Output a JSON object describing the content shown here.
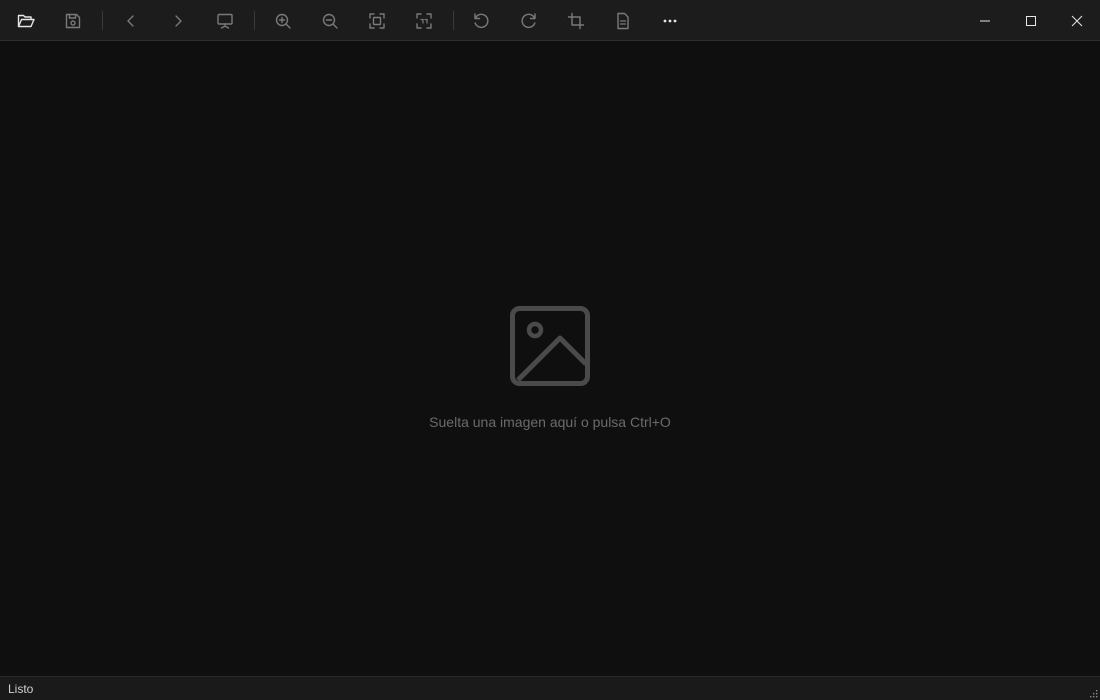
{
  "toolbar": {
    "buttons": [
      {
        "name": "open",
        "icon": "folder-open-icon",
        "enabled": true
      },
      {
        "name": "save",
        "icon": "save-icon",
        "enabled": false
      },
      {
        "name": "previous",
        "icon": "chevron-left-icon",
        "enabled": false
      },
      {
        "name": "next",
        "icon": "chevron-right-icon",
        "enabled": false
      },
      {
        "name": "slideshow",
        "icon": "presentation-icon",
        "enabled": false
      },
      {
        "name": "zoom-in",
        "icon": "zoom-in-icon",
        "enabled": false
      },
      {
        "name": "zoom-out",
        "icon": "zoom-out-icon",
        "enabled": false
      },
      {
        "name": "fit-to-window",
        "icon": "fit-screen-icon",
        "enabled": false
      },
      {
        "name": "actual-size",
        "icon": "actual-size-icon",
        "enabled": false
      },
      {
        "name": "rotate-left",
        "icon": "rotate-left-icon",
        "enabled": false
      },
      {
        "name": "rotate-right",
        "icon": "rotate-right-icon",
        "enabled": false
      },
      {
        "name": "crop",
        "icon": "crop-icon",
        "enabled": false
      },
      {
        "name": "info",
        "icon": "document-icon",
        "enabled": false
      },
      {
        "name": "more",
        "icon": "more-icon",
        "enabled": true
      }
    ]
  },
  "window_controls": [
    "minimize-icon",
    "maximize-icon",
    "close-icon"
  ],
  "canvas": {
    "empty_icon": "image-placeholder-icon",
    "empty_message": "Suelta una imagen aquí o pulsa Ctrl+O"
  },
  "status": {
    "text": "Listo"
  },
  "colors": {
    "background": "#0f0f0f",
    "toolbar": "#1c1c1c",
    "icon_enabled": "#e6e6e6",
    "icon_disabled": "#7a7a7a",
    "placeholder": "#4a4a4a",
    "placeholder_text": "#6b6b6b"
  }
}
